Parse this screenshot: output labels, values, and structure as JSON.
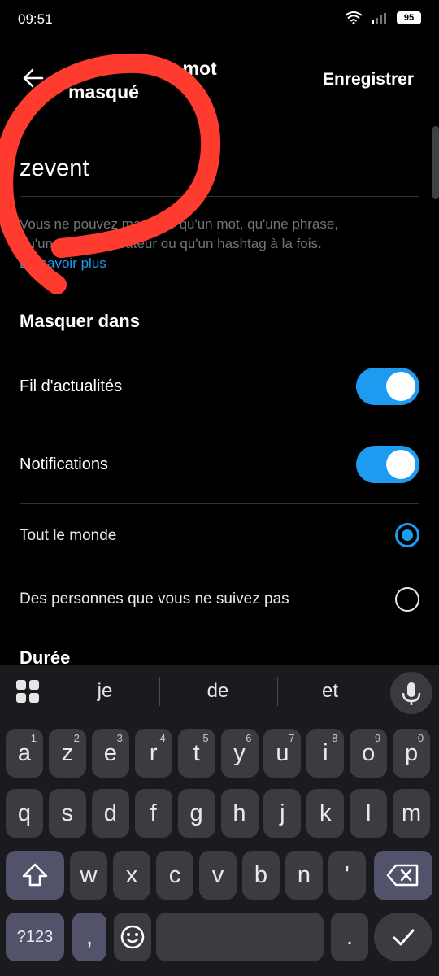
{
  "status_bar": {
    "time": "09:51",
    "battery": "95"
  },
  "header": {
    "title": "Masquer un mot masqué",
    "title_visible": "un mot",
    "title_line2": "masqué",
    "save_label": "Enregistrer"
  },
  "input": {
    "value": "zevent"
  },
  "help": {
    "text_line1": "Vous ne pouvez masquer qu'un mot, qu'une phrase,",
    "text_line2": "qu'un nom d'utilisateur ou qu'un hashtag à la fois.",
    "link": "En savoir plus"
  },
  "mute_in": {
    "section_title": "Masquer dans",
    "rows": [
      {
        "label": "Fil d'actualités",
        "on": true
      },
      {
        "label": "Notifications",
        "on": true
      }
    ]
  },
  "audience": {
    "options": [
      {
        "label": "Tout le monde",
        "selected": true
      },
      {
        "label": "Des personnes que vous ne suivez pas",
        "selected": false
      }
    ]
  },
  "duration": {
    "section_title": "Durée"
  },
  "keyboard": {
    "suggestions": [
      "je",
      "de",
      "et"
    ],
    "row1": [
      {
        "k": "a",
        "n": "1"
      },
      {
        "k": "z",
        "n": "2"
      },
      {
        "k": "e",
        "n": "3"
      },
      {
        "k": "r",
        "n": "4"
      },
      {
        "k": "t",
        "n": "5"
      },
      {
        "k": "y",
        "n": "6"
      },
      {
        "k": "u",
        "n": "7"
      },
      {
        "k": "i",
        "n": "8"
      },
      {
        "k": "o",
        "n": "9"
      },
      {
        "k": "p",
        "n": "0"
      }
    ],
    "row2": [
      "q",
      "s",
      "d",
      "f",
      "g",
      "h",
      "j",
      "k",
      "l",
      "m"
    ],
    "row3": [
      "w",
      "x",
      "c",
      "v",
      "b",
      "n",
      "'"
    ],
    "symbols_label": "?123",
    "comma": ",",
    "period": "."
  },
  "colors": {
    "accent": "#1d9bf0",
    "background": "#000000",
    "scribble": "#ff3b30"
  }
}
